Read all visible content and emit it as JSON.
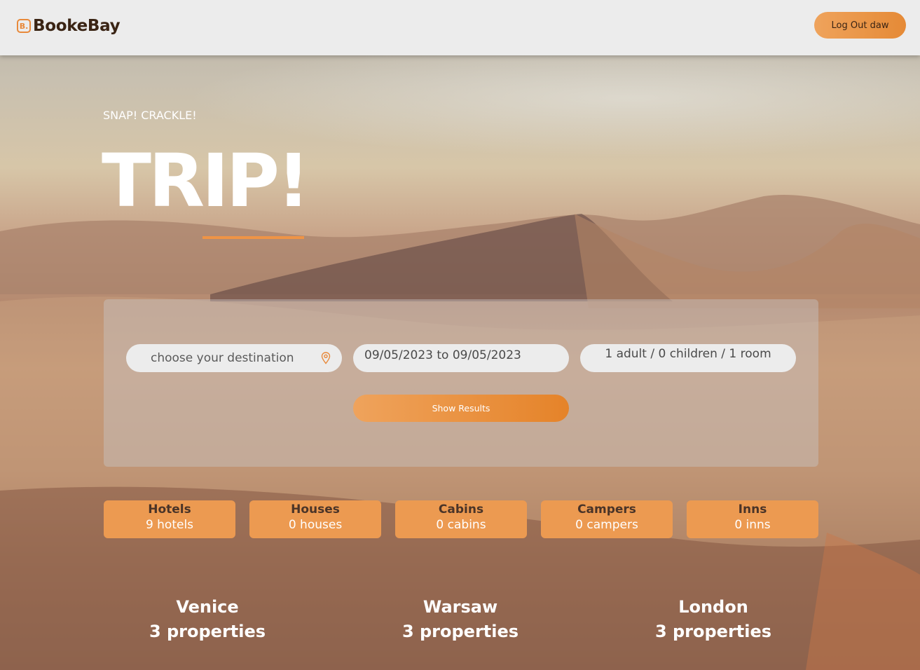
{
  "header": {
    "logo_mark": "B.",
    "logo_text": "BookeBay",
    "logout_label": "Log Out daw"
  },
  "hero": {
    "kicker": "SNAP! CRACKLE!",
    "title": "TRIP!"
  },
  "search": {
    "destination_placeholder": "choose your destination",
    "dates_value": "09/05/2023 to 09/05/2023",
    "guests_value": "1 adult / 0 children / 1 room",
    "submit_label": "Show Results"
  },
  "categories": [
    {
      "name": "Hotels",
      "count": "9 hotels"
    },
    {
      "name": "Houses",
      "count": "0 houses"
    },
    {
      "name": "Cabins",
      "count": "0 cabins"
    },
    {
      "name": "Campers",
      "count": "0 campers"
    },
    {
      "name": "Inns",
      "count": "0 inns"
    }
  ],
  "cities": [
    {
      "name": "Venice",
      "properties": "3 properties"
    },
    {
      "name": "Warsaw",
      "properties": "3 properties"
    },
    {
      "name": "London",
      "properties": "3 properties"
    }
  ],
  "colors": {
    "accent": "#ec9a51",
    "header_bg": "#ececec",
    "brand_text": "#3a2414"
  },
  "icons": {
    "logo": "bookebay-logo-icon",
    "destination": "map-pin-icon"
  }
}
